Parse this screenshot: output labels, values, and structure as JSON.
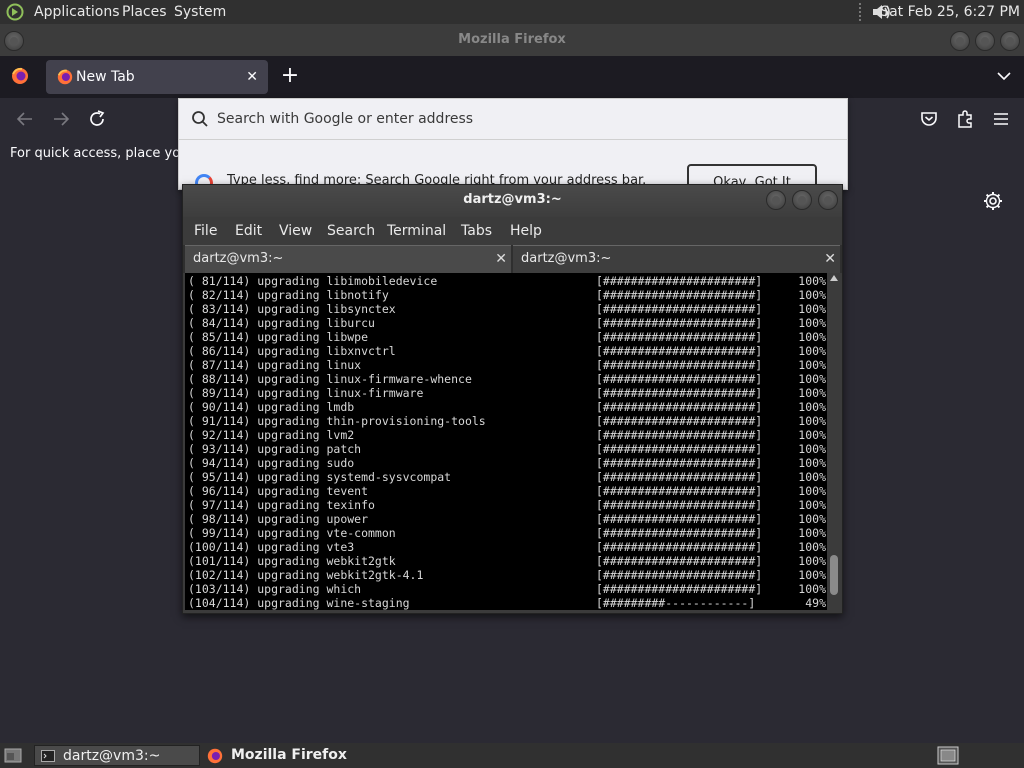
{
  "top_panel": {
    "menus": [
      "Applications",
      "Places",
      "System"
    ],
    "clock": "Sat Feb 25,  6:27 PM"
  },
  "firefox": {
    "window_title": "Mozilla Firefox",
    "tab_label": "New Tab",
    "new_tab_symbol": "+",
    "tab_close_symbol": "✕",
    "bookmark_hint": "For quick access, place your",
    "url_placeholder": "Search with Google or enter address",
    "suggestion_text": "Type less, find more: Search Google right from your address bar.",
    "suggestion_button": "Okay, Got It"
  },
  "terminal": {
    "window_title": "dartz@vm3:~",
    "menu": [
      "File",
      "Edit",
      "View",
      "Search",
      "Terminal",
      "Tabs",
      "Help"
    ],
    "tabs": [
      {
        "label": "dartz@vm3:~",
        "close": "✕"
      },
      {
        "label": "dartz@vm3:~",
        "close": "✕"
      }
    ],
    "lines": [
      {
        "text": "( 81/114) upgrading libimobiledevice",
        "bar": "[######################]",
        "pct": "100%"
      },
      {
        "text": "( 82/114) upgrading libnotify",
        "bar": "[######################]",
        "pct": "100%"
      },
      {
        "text": "( 83/114) upgrading libsynctex",
        "bar": "[######################]",
        "pct": "100%"
      },
      {
        "text": "( 84/114) upgrading liburcu",
        "bar": "[######################]",
        "pct": "100%"
      },
      {
        "text": "( 85/114) upgrading libwpe",
        "bar": "[######################]",
        "pct": "100%"
      },
      {
        "text": "( 86/114) upgrading libxnvctrl",
        "bar": "[######################]",
        "pct": "100%"
      },
      {
        "text": "( 87/114) upgrading linux",
        "bar": "[######################]",
        "pct": "100%"
      },
      {
        "text": "( 88/114) upgrading linux-firmware-whence",
        "bar": "[######################]",
        "pct": "100%"
      },
      {
        "text": "( 89/114) upgrading linux-firmware",
        "bar": "[######################]",
        "pct": "100%"
      },
      {
        "text": "( 90/114) upgrading lmdb",
        "bar": "[######################]",
        "pct": "100%"
      },
      {
        "text": "( 91/114) upgrading thin-provisioning-tools",
        "bar": "[######################]",
        "pct": "100%"
      },
      {
        "text": "( 92/114) upgrading lvm2",
        "bar": "[######################]",
        "pct": "100%"
      },
      {
        "text": "( 93/114) upgrading patch",
        "bar": "[######################]",
        "pct": "100%"
      },
      {
        "text": "( 94/114) upgrading sudo",
        "bar": "[######################]",
        "pct": "100%"
      },
      {
        "text": "( 95/114) upgrading systemd-sysvcompat",
        "bar": "[######################]",
        "pct": "100%"
      },
      {
        "text": "( 96/114) upgrading tevent",
        "bar": "[######################]",
        "pct": "100%"
      },
      {
        "text": "( 97/114) upgrading texinfo",
        "bar": "[######################]",
        "pct": "100%"
      },
      {
        "text": "( 98/114) upgrading upower",
        "bar": "[######################]",
        "pct": "100%"
      },
      {
        "text": "( 99/114) upgrading vte-common",
        "bar": "[######################]",
        "pct": "100%"
      },
      {
        "text": "(100/114) upgrading vte3",
        "bar": "[######################]",
        "pct": "100%"
      },
      {
        "text": "(101/114) upgrading webkit2gtk",
        "bar": "[######################]",
        "pct": "100%"
      },
      {
        "text": "(102/114) upgrading webkit2gtk-4.1",
        "bar": "[######################]",
        "pct": "100%"
      },
      {
        "text": "(103/114) upgrading which",
        "bar": "[######################]",
        "pct": "100%"
      },
      {
        "text": "(104/114) upgrading wine-staging",
        "bar": "[#########------------]",
        "pct": "49%"
      }
    ]
  },
  "bottom_panel": {
    "tasks": [
      "dartz@vm3:~",
      "Mozilla Firefox"
    ]
  }
}
